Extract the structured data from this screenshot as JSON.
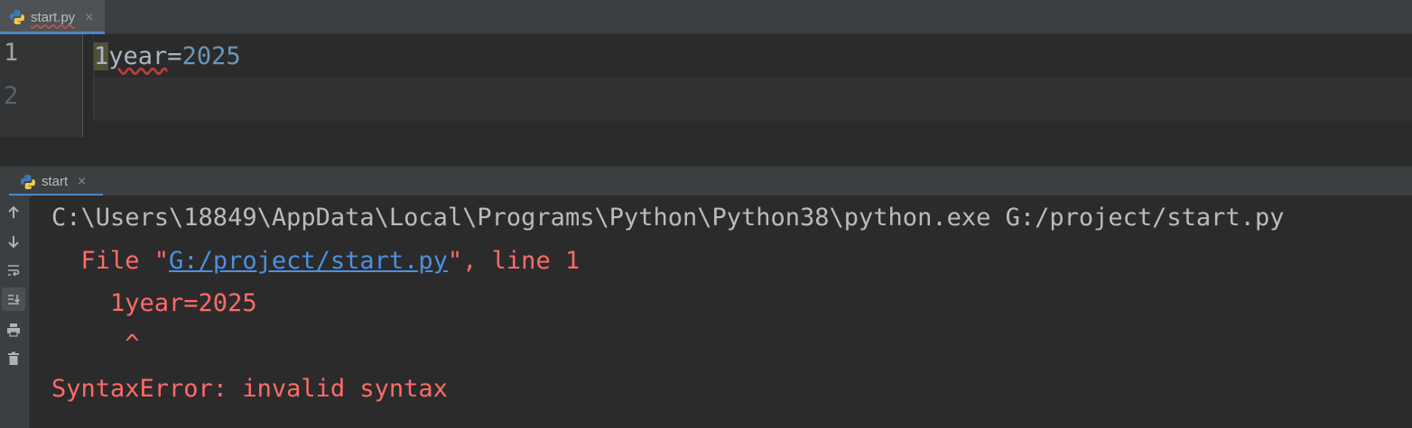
{
  "editor": {
    "tab": {
      "label": "start.py",
      "close": "×"
    },
    "lines": [
      {
        "number": "1",
        "prefix": "1",
        "name": "year",
        "op": "=",
        "value": "2025"
      },
      {
        "number": "2"
      }
    ]
  },
  "run": {
    "tab": {
      "label": "start",
      "close": "×"
    },
    "toolbar": [
      "up-arrow-icon",
      "down-arrow-icon",
      "soft-wrap-icon",
      "scroll-to-end-icon",
      "print-icon",
      "trash-icon"
    ],
    "console": {
      "command": "C:\\Users\\18849\\AppData\\Local\\Programs\\Python\\Python38\\python.exe G:/project/start.py",
      "file_prefix": "  File \"",
      "file_link": "G:/project/start.py",
      "file_suffix": "\", line 1",
      "code": "    1year=2025",
      "caret": "     ^",
      "error": "SyntaxError: invalid syntax"
    }
  },
  "colors": {
    "background": "#2b2b2b",
    "error_text": "#ff6b68",
    "link": "#4d8fe0",
    "number": "#6897bb",
    "identifier": "#a9b7c6"
  }
}
